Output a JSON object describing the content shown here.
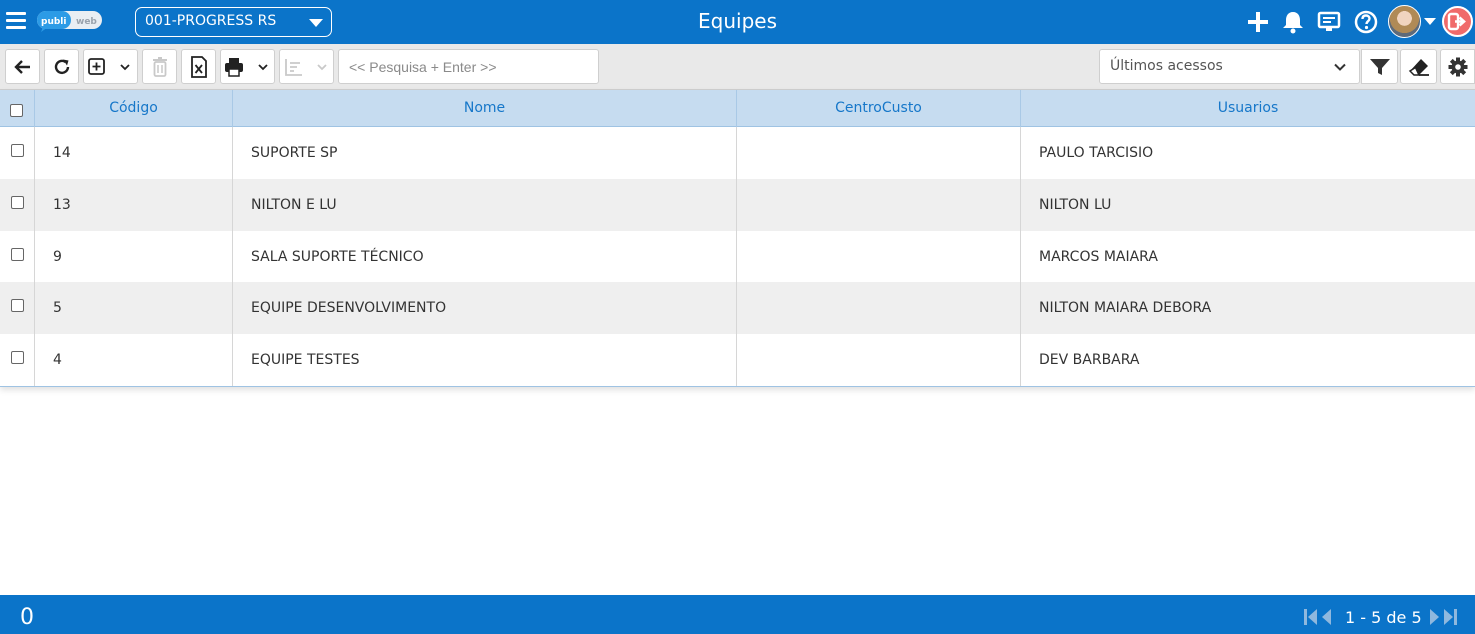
{
  "header": {
    "logo_text_left": "publi",
    "logo_text_right": "web",
    "company": "001-PROGRESS RS",
    "title": "Equipes",
    "icons": [
      "menu-icon",
      "plus-icon",
      "bell-icon",
      "monitor-icon",
      "help-icon",
      "avatar",
      "logout-icon"
    ]
  },
  "toolbar": {
    "search_placeholder": "<< Pesquisa + Enter >>",
    "recent_label": "Últimos acessos",
    "icons": [
      "back-arrow-icon",
      "refresh-icon",
      "add-icon",
      "trash-icon",
      "excel-icon",
      "print-icon",
      "sort-icon",
      "filter-icon",
      "eraser-icon",
      "gear-icon"
    ]
  },
  "table": {
    "columns": [
      "Código",
      "Nome",
      "CentroCusto",
      "Usuarios"
    ],
    "rows": [
      {
        "codigo": "14",
        "nome": "SUPORTE SP",
        "centro": "",
        "usuarios": "PAULO TARCISIO"
      },
      {
        "codigo": "13",
        "nome": "NILTON E LU",
        "centro": "",
        "usuarios": "NILTON LU"
      },
      {
        "codigo": "9",
        "nome": "SALA SUPORTE TÉCNICO",
        "centro": "",
        "usuarios": "MARCOS MAIARA"
      },
      {
        "codigo": "5",
        "nome": "EQUIPE DESENVOLVIMENTO",
        "centro": "",
        "usuarios": "NILTON MAIARA DEBORA"
      },
      {
        "codigo": "4",
        "nome": "EQUIPE TESTES",
        "centro": "",
        "usuarios": "DEV BARBARA"
      }
    ]
  },
  "footer": {
    "selected_count": "0",
    "pager": "1 - 5 de 5"
  },
  "colors": {
    "primary": "#0b74c9",
    "header_row": "#c6dcf0",
    "alt_row": "#efefef",
    "link": "#1677c9",
    "logout": "#f06b6b"
  }
}
